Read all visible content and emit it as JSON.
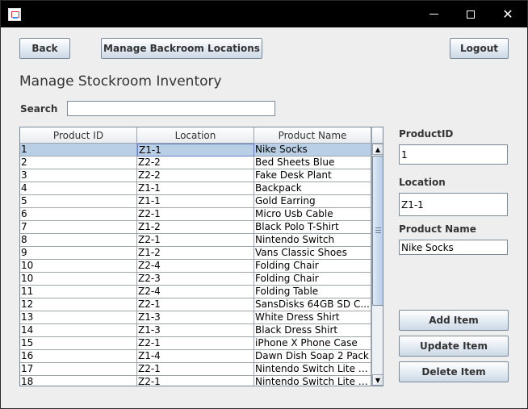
{
  "window": {
    "title": "",
    "controls": {
      "minimize": "minimize",
      "maximize": "maximize",
      "close": "close"
    }
  },
  "toolbar": {
    "back_label": "Back",
    "manage_label": "Manage Backroom Locations",
    "logout_label": "Logout"
  },
  "page_title": "Manage Stockroom Inventory",
  "search": {
    "label": "Search",
    "value": ""
  },
  "table": {
    "columns": [
      "Product ID",
      "Location",
      "Product Name"
    ],
    "rows": [
      [
        "1",
        "Z1-1",
        "Nike Socks"
      ],
      [
        "2",
        "Z2-2",
        "Bed Sheets Blue"
      ],
      [
        "3",
        "Z2-2",
        "Fake Desk Plant"
      ],
      [
        "4",
        "Z1-1",
        "Backpack"
      ],
      [
        "5",
        "Z1-1",
        "Gold Earring"
      ],
      [
        "6",
        "Z2-1",
        "Micro Usb Cable"
      ],
      [
        "7",
        "Z1-2",
        "Black Polo T-Shirt"
      ],
      [
        "8",
        "Z2-1",
        "Nintendo Switch"
      ],
      [
        "9",
        "Z1-2",
        "Vans Classic Shoes"
      ],
      [
        "10",
        "Z2-4",
        "Folding Chair"
      ],
      [
        "10",
        "Z2-3",
        "Folding Chair"
      ],
      [
        "11",
        "Z2-4",
        "Folding Table"
      ],
      [
        "12",
        "Z2-1",
        "SansDisks 64GB SD C..."
      ],
      [
        "13",
        "Z1-3",
        "White Dress Shirt"
      ],
      [
        "14",
        "Z1-3",
        "Black Dress Shirt"
      ],
      [
        "15",
        "Z2-1",
        "iPhone X Phone Case"
      ],
      [
        "16",
        "Z1-4",
        "Dawn Dish Soap 2 Pack"
      ],
      [
        "17",
        "Z2-1",
        "Nintendo Switch Lite Co..."
      ],
      [
        "18",
        "Z2-1",
        "Nintendo Switch Lite S..."
      ]
    ],
    "selected_row": 0
  },
  "form": {
    "product_id_label": "ProductID",
    "product_id_value": "1",
    "location_label": "Location",
    "location_value": "Z1-1",
    "product_name_label": "Product Name",
    "product_name_value": "Nike Socks"
  },
  "actions": {
    "add_label": "Add Item",
    "update_label": "Update Item",
    "delete_label": "Delete Item"
  },
  "icons": {
    "scroll_up": "▲",
    "scroll_down": "▼"
  }
}
